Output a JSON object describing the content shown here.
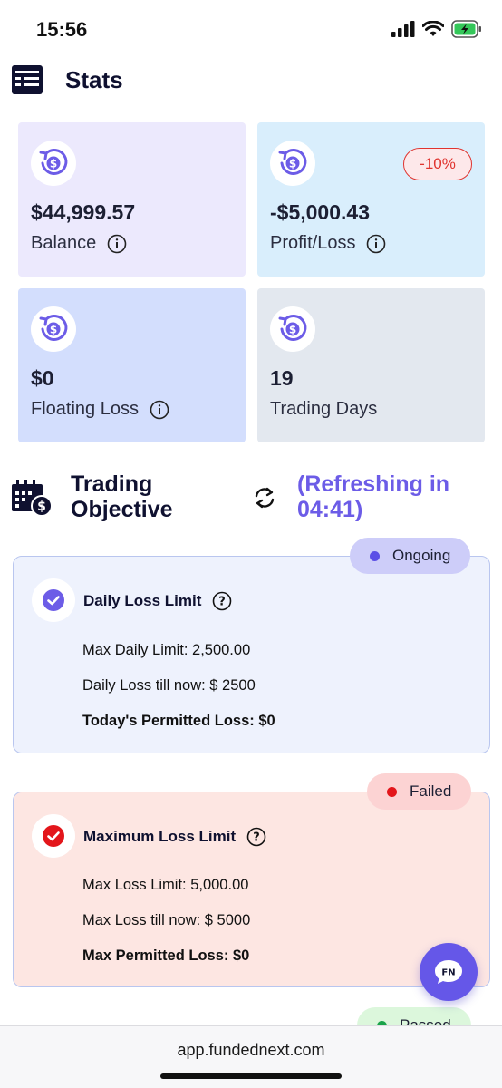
{
  "status_bar": {
    "time": "15:56"
  },
  "header": {
    "title": "Stats"
  },
  "stats": {
    "balance": {
      "value": "$44,999.57",
      "label": "Balance"
    },
    "profit_loss": {
      "value": "-$5,000.43",
      "label": "Profit/Loss",
      "badge": "-10%"
    },
    "floating_loss": {
      "value": "$0",
      "label": "Floating Loss"
    },
    "trading_days": {
      "value": "19",
      "label": "Trading Days"
    }
  },
  "objective": {
    "title": "Trading Objective",
    "refresh_text": "(Refreshing in 04:41)"
  },
  "daily_loss": {
    "status": "Ongoing",
    "title": "Daily Loss Limit",
    "max_limit": "Max Daily Limit: 2,500.00",
    "loss_till_now": "Daily Loss till now: $ 2500",
    "permitted": "Today's Permitted Loss: $0"
  },
  "max_loss": {
    "status": "Failed",
    "title": "Maximum Loss Limit",
    "max_limit": "Max Loss Limit: 5,000.00",
    "loss_till_now": "Max Loss till now: $ 5000",
    "permitted": "Max Permitted Loss: $0"
  },
  "next_status": {
    "status": "Passed"
  },
  "chat": {
    "label": "FN"
  },
  "browser": {
    "url": "app.fundednext.com"
  },
  "colors": {
    "accent": "#6c5ce7",
    "balance_bg": "#ece9fd",
    "profit_bg": "#d9eefc",
    "floating_bg": "#d3defd",
    "days_bg": "#e3e8ef",
    "ongoing_panel": "#eef2fd",
    "failed_panel": "#fde6e2"
  }
}
